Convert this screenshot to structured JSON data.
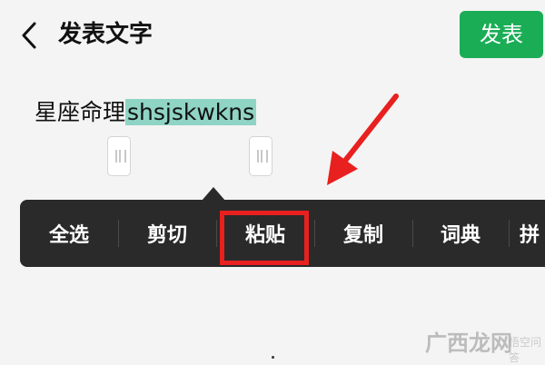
{
  "header": {
    "title": "发表文字",
    "publish_label": "发表",
    "back_icon": "chevron-left-icon"
  },
  "editor": {
    "plain_text": "星座命理",
    "selected_text": "shsjskwkns"
  },
  "context_menu": {
    "items": [
      {
        "label": "全选"
      },
      {
        "label": "剪切"
      },
      {
        "label": "粘贴",
        "highlighted": true
      },
      {
        "label": "复制"
      },
      {
        "label": "词典"
      },
      {
        "label": "拼"
      }
    ]
  },
  "annotation": {
    "arrow_color": "#e8201f",
    "box_color": "#e8201f"
  },
  "watermark": {
    "text": "广西龙网",
    "subtext": "悟空问答"
  },
  "colors": {
    "accent": "#1aad56",
    "selection": "#8fd4c5",
    "menu_bg": "#2a2a2a"
  }
}
